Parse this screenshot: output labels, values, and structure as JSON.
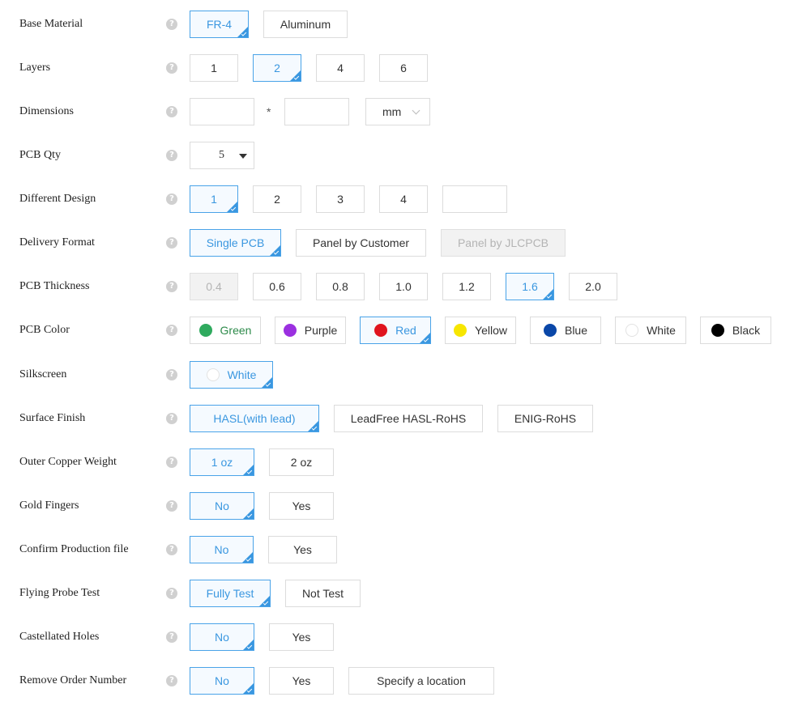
{
  "help_glyph": "?",
  "base_material": {
    "label": "Base Material",
    "options": [
      "FR-4",
      "Aluminum"
    ]
  },
  "layers": {
    "label": "Layers",
    "options": [
      "1",
      "2",
      "4",
      "6"
    ]
  },
  "dimensions": {
    "label": "Dimensions",
    "width_value": "",
    "length_value": "",
    "separator": "*",
    "unit": "mm"
  },
  "pcb_qty": {
    "label": "PCB Qty",
    "value": "5"
  },
  "different_design": {
    "label": "Different Design",
    "options": [
      "1",
      "2",
      "3",
      "4"
    ],
    "custom_value": ""
  },
  "delivery_format": {
    "label": "Delivery Format",
    "options": [
      "Single PCB",
      "Panel by Customer",
      "Panel by JLCPCB"
    ]
  },
  "pcb_thickness": {
    "label": "PCB Thickness",
    "options": [
      "0.4",
      "0.6",
      "0.8",
      "1.0",
      "1.2",
      "1.6",
      "2.0"
    ]
  },
  "pcb_color": {
    "label": "PCB Color",
    "options": [
      {
        "name": "Green",
        "color": "#2faa5e",
        "text_color": "#2d8a4a"
      },
      {
        "name": "Purple",
        "color": "#9b30e0"
      },
      {
        "name": "Red",
        "color": "#e0141e"
      },
      {
        "name": "Yellow",
        "color": "#f7e600"
      },
      {
        "name": "Blue",
        "color": "#0a47a8"
      },
      {
        "name": "White",
        "color": "#ffffff"
      },
      {
        "name": "Black",
        "color": "#000000"
      }
    ]
  },
  "silkscreen": {
    "label": "Silkscreen",
    "options": [
      {
        "name": "White",
        "color": "#ffffff"
      }
    ]
  },
  "surface_finish": {
    "label": "Surface Finish",
    "options": [
      "HASL(with lead)",
      "LeadFree HASL-RoHS",
      "ENIG-RoHS"
    ]
  },
  "outer_copper_weight": {
    "label": "Outer Copper Weight",
    "options": [
      "1 oz",
      "2 oz"
    ]
  },
  "gold_fingers": {
    "label": "Gold Fingers",
    "options": [
      "No",
      "Yes"
    ]
  },
  "confirm_production_file": {
    "label": "Confirm Production file",
    "options": [
      "No",
      "Yes"
    ]
  },
  "flying_probe_test": {
    "label": "Flying Probe Test",
    "options": [
      "Fully Test",
      "Not Test"
    ]
  },
  "castellated_holes": {
    "label": "Castellated Holes",
    "options": [
      "No",
      "Yes"
    ]
  },
  "remove_order_number": {
    "label": "Remove Order Number",
    "options": [
      "No",
      "Yes",
      "Specify a location"
    ]
  },
  "colors": {
    "accent": "#3a97e0",
    "selected_border": "#4aa3e8",
    "selected_bg": "#f5faff",
    "disabled_bg": "#f2f2f2"
  }
}
